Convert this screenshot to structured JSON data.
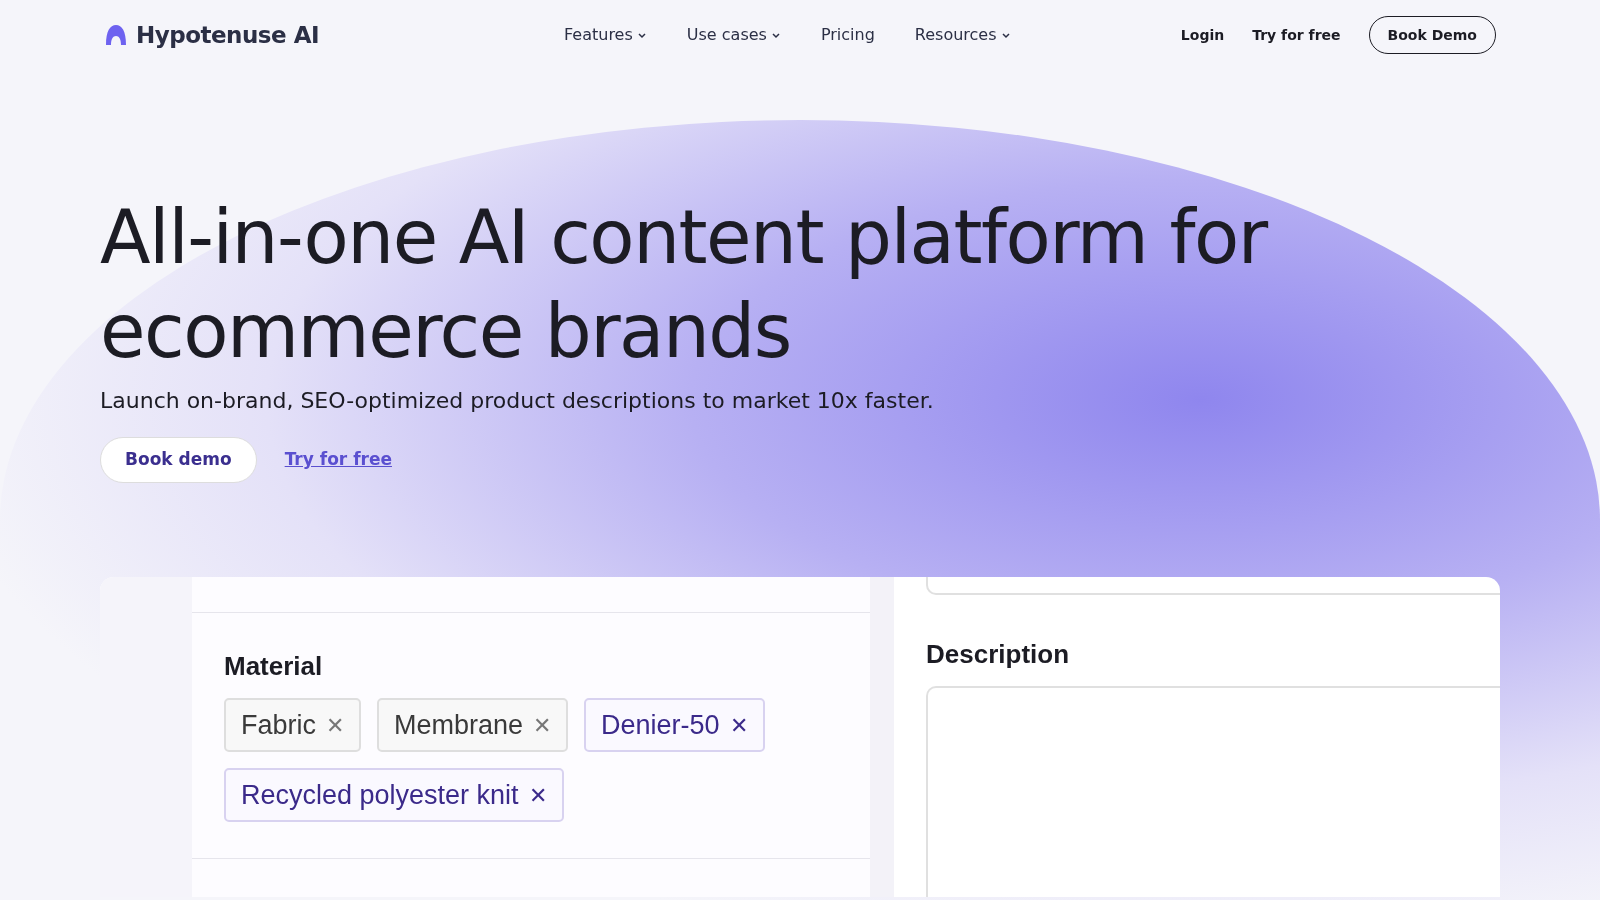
{
  "brand": {
    "name": "Hypotenuse AI"
  },
  "nav": [
    {
      "label": "Features",
      "dropdown": true
    },
    {
      "label": "Use cases",
      "dropdown": true
    },
    {
      "label": "Pricing",
      "dropdown": false
    },
    {
      "label": "Resources",
      "dropdown": true
    }
  ],
  "header_actions": {
    "login": "Login",
    "try": "Try for free",
    "demo": "Book Demo"
  },
  "hero": {
    "title": "All-in-one AI content platform for ecommerce brands",
    "subtitle": "Launch on-brand, SEO-optimized product descriptions to market 10x faster.",
    "primary": "Book demo",
    "secondary": "Try for free"
  },
  "preview": {
    "material_label": "Material",
    "tags": [
      {
        "label": "Fabric",
        "highlighted": false,
        "remove": "✕"
      },
      {
        "label": "Membrane",
        "highlighted": false,
        "remove": "✕"
      },
      {
        "label": "Denier-50",
        "highlighted": true,
        "remove": "✕"
      },
      {
        "label": "Recycled polyester knit",
        "highlighted": true,
        "remove": "✕"
      }
    ],
    "description_label": "Description"
  }
}
